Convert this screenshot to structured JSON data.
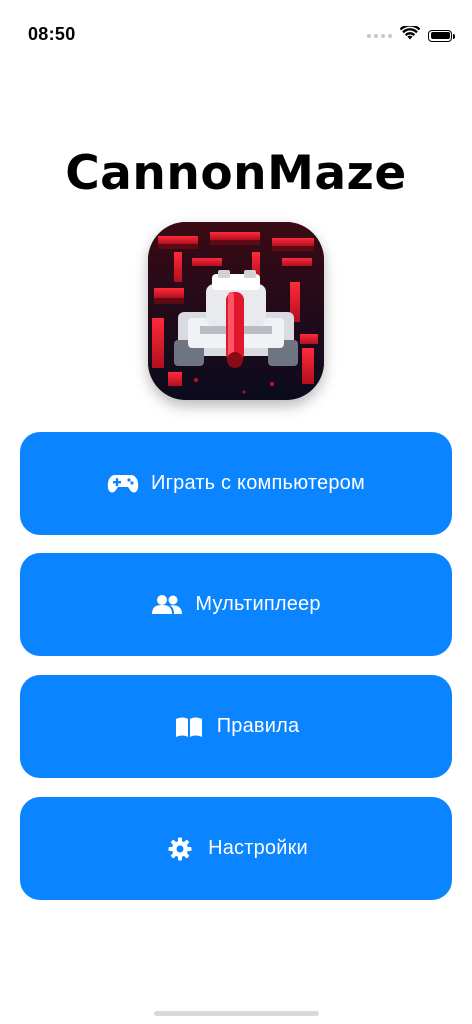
{
  "status_bar": {
    "time": "08:50"
  },
  "app": {
    "title": "CannonMaze",
    "icon": "tank-maze-app-icon"
  },
  "menu": [
    {
      "label": "Играть с компьютером",
      "icon": "gamepad-icon"
    },
    {
      "label": "Мультиплеер",
      "icon": "users-icon"
    },
    {
      "label": "Правила",
      "icon": "book-icon"
    },
    {
      "label": "Настройки",
      "icon": "gear-icon"
    }
  ],
  "colors": {
    "accent": "#0a84ff",
    "background": "#ffffff",
    "text": "#000000"
  }
}
